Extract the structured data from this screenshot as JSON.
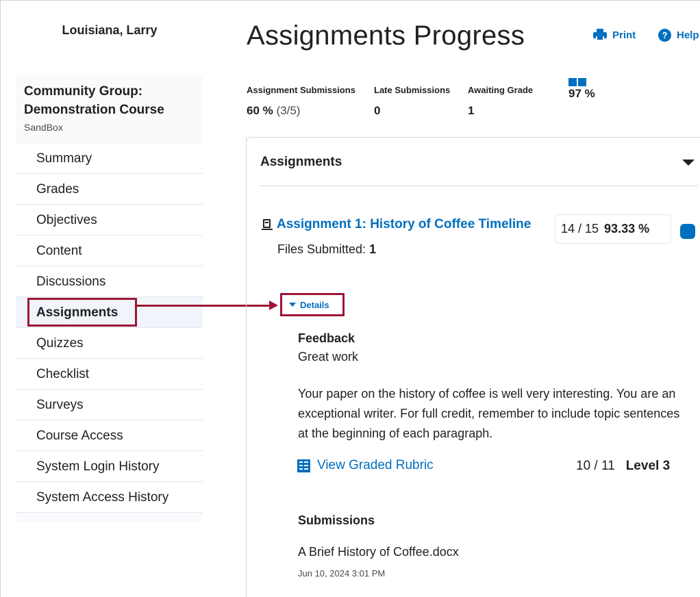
{
  "user": {
    "name": "Louisiana, Larry"
  },
  "course": {
    "title": "Community Group: Demonstration Course",
    "subtitle": "SandBox"
  },
  "nav": {
    "items": [
      {
        "label": "Summary"
      },
      {
        "label": "Grades"
      },
      {
        "label": "Objectives"
      },
      {
        "label": "Content"
      },
      {
        "label": "Discussions"
      },
      {
        "label": "Assignments",
        "active": true
      },
      {
        "label": "Quizzes"
      },
      {
        "label": "Checklist"
      },
      {
        "label": "Surveys"
      },
      {
        "label": "Course Access"
      },
      {
        "label": "System Login History"
      },
      {
        "label": "System Access History"
      }
    ]
  },
  "header": {
    "title": "Assignments Progress",
    "print_label": "Print",
    "help_label": "Help",
    "help_glyph": "?",
    "print_icon": "printer-icon",
    "help_icon": "help-circle-icon"
  },
  "stats": {
    "submissions": {
      "label": "Assignment Submissions",
      "value": "60 %",
      "detail": "(3/5)"
    },
    "late": {
      "label": "Late Submissions",
      "value": "0"
    },
    "awaiting": {
      "label": "Awaiting Grade",
      "value": "1"
    },
    "grade": {
      "icon": "grade-bars-icon",
      "value": "97 %"
    }
  },
  "panel": {
    "title": "Assignments",
    "assignment": {
      "icon": "assignment-icon",
      "title": "Assignment 1: History of Coffee Timeline",
      "score": "14 / 15",
      "percent": "93.33 %",
      "files_label": "Files Submitted:",
      "files_count": "1"
    },
    "details_label": "Details",
    "feedback": {
      "heading": "Feedback",
      "short": "Great work",
      "long": "Your paper on the history of coffee is well very interesting. You are an exceptional writer. For full credit, remember to include topic sentences at the beginning of each paragraph."
    },
    "rubric": {
      "icon": "rubric-icon",
      "link_label": "View Graded Rubric",
      "score": "10 / 11",
      "level": "Level 3"
    },
    "submissions": {
      "heading": "Submissions",
      "file": "A Brief History of Coffee.docx",
      "date": "Jun 10, 2024 3:01 PM"
    }
  },
  "colors": {
    "accent": "#006fbf",
    "highlight": "#9d1535",
    "text": "#202122"
  }
}
